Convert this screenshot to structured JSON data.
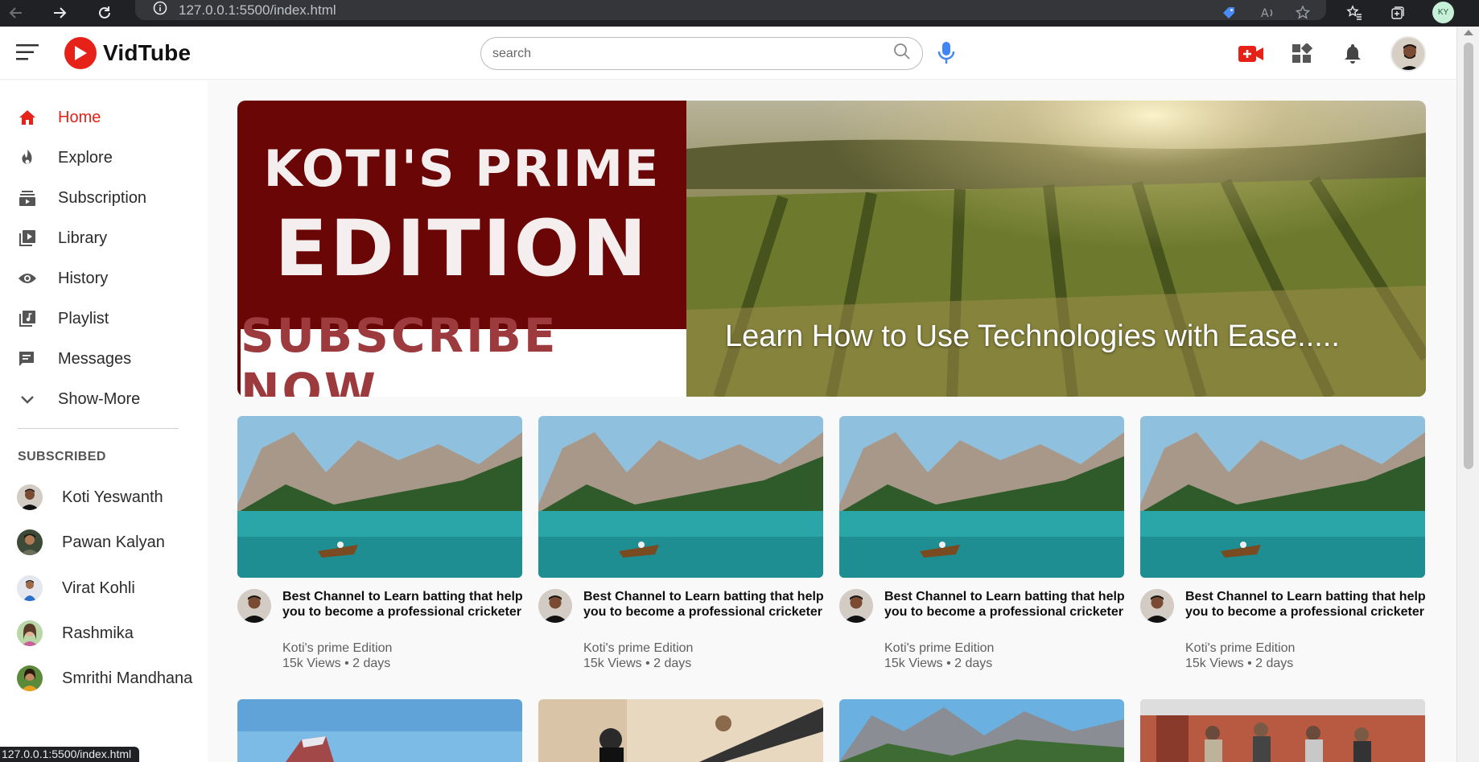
{
  "browser": {
    "url": "127.0.0.1:5500/index.html",
    "status_url": "127.0.0.1:5500/index.html",
    "profile_initials": "KY"
  },
  "header": {
    "brand": "VidTube",
    "search_placeholder": "search"
  },
  "sidebar": {
    "items": [
      {
        "label": "Home",
        "icon": "home-icon",
        "active": true
      },
      {
        "label": "Explore",
        "icon": "explore-icon"
      },
      {
        "label": "Subscription",
        "icon": "subscription-icon"
      },
      {
        "label": "Library",
        "icon": "library-icon"
      },
      {
        "label": "History",
        "icon": "history-icon"
      },
      {
        "label": "Playlist",
        "icon": "playlist-icon"
      },
      {
        "label": "Messages",
        "icon": "messages-icon"
      },
      {
        "label": "Show-More",
        "icon": "chevron-down-icon"
      }
    ],
    "subscribed_heading": "SUBSCRIBED",
    "subscribed": [
      {
        "name": "Koti Yeswanth"
      },
      {
        "name": "Pawan Kalyan"
      },
      {
        "name": "Virat Kohli"
      },
      {
        "name": "Rashmika"
      },
      {
        "name": "Smrithi Mandhana"
      }
    ]
  },
  "banner": {
    "line1": "KOTI'S PRIME",
    "line2": "EDITION",
    "cta": "SUBSCRIBE NOW",
    "tagline": "Learn How to Use Technologies with Ease....."
  },
  "videos": [
    {
      "title": "Best Channel to Learn batting that help you to become a professional cricketer",
      "channel": "Koti's prime Edition",
      "stats": "15k Views • 2 days"
    },
    {
      "title": "Best Channel to Learn batting that help you to become a professional cricketer",
      "channel": "Koti's prime Edition",
      "stats": "15k Views • 2 days"
    },
    {
      "title": "Best Channel to Learn batting that help you to become a professional cricketer",
      "channel": "Koti's prime Edition",
      "stats": "15k Views • 2 days"
    },
    {
      "title": "Best Channel to Learn batting that help you to become a professional cricketer",
      "channel": "Koti's prime Edition",
      "stats": "15k Views • 2 days"
    }
  ],
  "colors": {
    "accent": "#e62117",
    "banner_red": "#6b0607"
  }
}
